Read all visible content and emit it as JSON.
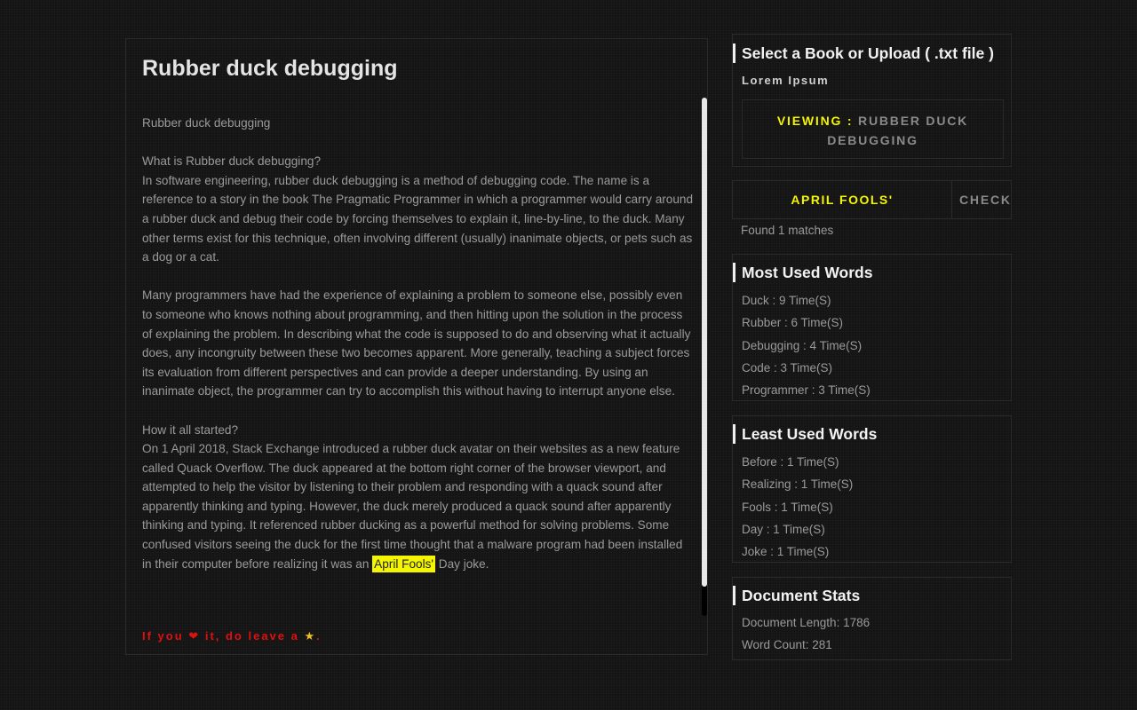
{
  "main": {
    "title": "Rubber duck debugging",
    "paragraphs": [
      "Rubber duck debugging",
      "What is Rubber duck debugging?\nIn software engineering, rubber duck debugging is a method of debugging code. The name is a reference to a story in the book The Pragmatic Programmer in which a programmer would carry around a rubber duck and debug their code by forcing themselves to explain it, line-by-line, to the duck. Many other terms exist for this technique, often involving different (usually) inanimate objects, or pets such as a dog or a cat.",
      "Many programmers have had the experience of explaining a problem to someone else, possibly even to someone who knows nothing about programming, and then hitting upon the solution in the process of explaining the problem. In describing what the code is supposed to do and observing what it actually does, any incongruity between these two becomes apparent. More generally, teaching a subject forces its evaluation from different perspectives and can provide a deeper understanding. By using an inanimate object, the programmer can try to accomplish this without having to interrupt anyone else."
    ],
    "last_paragraph_before": "How it all started?\nOn 1 April 2018, Stack Exchange introduced a rubber duck avatar on their websites as a new feature called Quack Overflow. The duck appeared at the bottom right corner of the browser viewport, and attempted to help the visitor by listening to their problem and responding with a quack sound after apparently thinking and typing. However, the duck merely produced a quack sound after apparently thinking and typing. It referenced rubber ducking as a powerful method for solving problems. Some confused visitors seeing the duck for the first time thought that a malware program had been installed in their computer before realizing it was an ",
    "highlight": "April Fools'",
    "last_paragraph_after": " Day joke.",
    "footer": {
      "part1": "If you",
      "heart": "❤",
      "part2": "it, do leave a",
      "star": "★",
      "end": "."
    }
  },
  "book_select": {
    "title": "Select a Book or Upload ( .txt file )",
    "book_name": "Lorem Ipsum",
    "viewing_label": "VIEWING :",
    "viewing_value": "RUBBER DUCK DEBUGGING"
  },
  "search": {
    "value": "APRIL FOOLS'",
    "check_label": "CHECK",
    "result": "Found 1 matches"
  },
  "most_used": {
    "title": "Most Used Words",
    "items": [
      "Duck : 9 Time(S)",
      "Rubber : 6 Time(S)",
      "Debugging : 4 Time(S)",
      "Code : 3 Time(S)",
      "Programmer : 3 Time(S)"
    ]
  },
  "least_used": {
    "title": "Least Used Words",
    "items": [
      "Before : 1 Time(S)",
      "Realizing : 1 Time(S)",
      "Fools : 1 Time(S)",
      "Day : 1 Time(S)",
      "Joke : 1 Time(S)"
    ]
  },
  "stats": {
    "title": "Document Stats",
    "items": [
      "Document Length: 1786",
      "Word Count: 281"
    ]
  },
  "colors": {
    "background": "#141414",
    "highlight": "#f5f500",
    "footer": "#e01010",
    "star": "#f0c020"
  }
}
